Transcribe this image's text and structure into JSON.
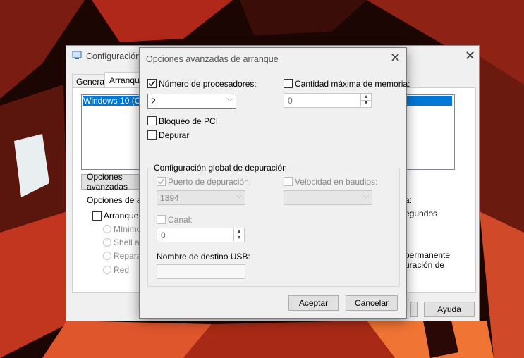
{
  "bg_dialog": {
    "title": "Configuración",
    "tabs": [
      "General",
      "Arranque"
    ],
    "list_item": "Windows 10 (C:\\",
    "advanced_button": "Opciones avanzadas",
    "boot_options_group": "Opciones de arr",
    "safe_boot_label": "Arranque a",
    "radios": [
      "Mínimo",
      "Shell alt",
      "Reparar",
      "Red"
    ],
    "right_texts": [
      "a:",
      "egundos",
      "permanente",
      "uración de"
    ],
    "help_button": "Ayuda"
  },
  "dialog": {
    "title": "Opciones avanzadas de arranque",
    "num_processors": {
      "label": "Número de procesadores:",
      "checked": true,
      "value": "2"
    },
    "max_memory": {
      "label": "Cantidad máxima de memoria:",
      "checked": false,
      "value": "0"
    },
    "pci_lock": {
      "label": "Bloqueo de PCI",
      "checked": false
    },
    "debug": {
      "label": "Depurar",
      "checked": false
    },
    "debug_group": {
      "title": "Configuración global de depuración",
      "debug_port": {
        "label": "Puerto de depuración:",
        "checked": true,
        "value": "1394"
      },
      "baud_rate": {
        "label": "Velocidad en baudios:",
        "checked": false,
        "value": ""
      },
      "channel": {
        "label": "Canal:",
        "checked": false,
        "value": "0"
      },
      "usb_target": {
        "label": "Nombre de destino USB:",
        "value": ""
      }
    },
    "ok_button": "Aceptar",
    "cancel_button": "Cancelar"
  }
}
